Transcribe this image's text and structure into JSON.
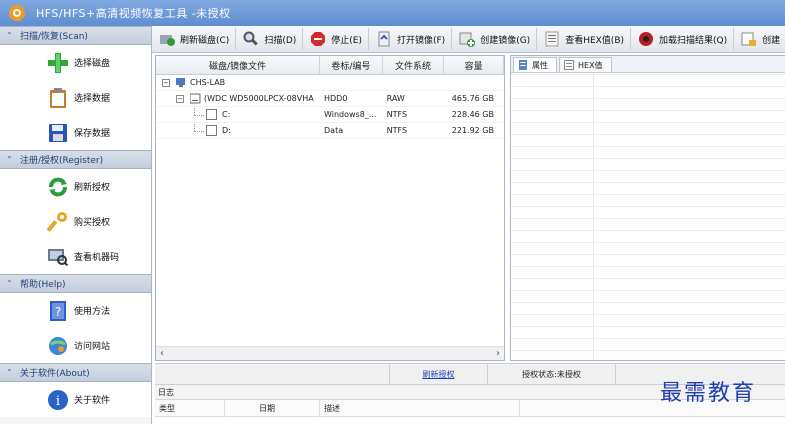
{
  "window": {
    "title": "HFS/HFS+高清视频恢复工具 -未授权",
    "logo_icon": "orange-gear-logo"
  },
  "sidebar": {
    "sections": [
      {
        "header": "扫描/恢复(Scan)",
        "items": [
          {
            "label": "选择磁盘",
            "icon": "green-plus-icon"
          },
          {
            "label": "选择数据",
            "icon": "clipboard-icon"
          },
          {
            "label": "保存数据",
            "icon": "floppy-disk-icon"
          }
        ]
      },
      {
        "header": "注册/授权(Register)",
        "items": [
          {
            "label": "刷新授权",
            "icon": "refresh-arrows-icon"
          },
          {
            "label": "购买授权",
            "icon": "key-icon"
          },
          {
            "label": "查看机器码",
            "icon": "monitor-search-icon"
          }
        ]
      },
      {
        "header": "帮助(Help)",
        "items": [
          {
            "label": "使用方法",
            "icon": "help-book-icon"
          },
          {
            "label": "访问网站",
            "icon": "globe-user-icon"
          }
        ]
      },
      {
        "header": "关于软件(About)",
        "items": [
          {
            "label": "关于软件",
            "icon": "info-icon"
          }
        ]
      }
    ]
  },
  "toolbar": {
    "buttons": [
      {
        "label": "刷新磁盘(C)",
        "icon": "refresh-disk-icon"
      },
      {
        "label": "扫描(D)",
        "icon": "magnifier-icon"
      },
      {
        "label": "停止(E)",
        "icon": "stop-icon"
      },
      {
        "label": "打开镜像(F)",
        "icon": "open-image-icon"
      },
      {
        "label": "创建镜像(G)",
        "icon": "create-image-icon"
      },
      {
        "label": "查看HEX值(B)",
        "icon": "hex-view-icon"
      },
      {
        "label": "加载扫描结果(Q)",
        "icon": "load-results-icon"
      },
      {
        "label": "创建",
        "icon": "create-icon"
      }
    ]
  },
  "tree": {
    "columns": [
      "磁盘/镜像文件",
      "卷标/编号",
      "文件系统",
      "容量"
    ],
    "rows": [
      {
        "name": "CHS-LAB",
        "label": "",
        "fs": "",
        "size": ""
      },
      {
        "name": "(WDC WD5000LPCX-08VHA",
        "label": "HDD0",
        "fs": "RAW",
        "size": "465.76 GB"
      },
      {
        "name": "C:",
        "label": "Windows8_...",
        "fs": "NTFS",
        "size": "228.46 GB"
      },
      {
        "name": "D:",
        "label": "Data",
        "fs": "NTFS",
        "size": "221.92 GB"
      }
    ]
  },
  "properties": {
    "tabs": [
      "属性",
      "HEX值"
    ]
  },
  "status": {
    "refresh_link": "刷新授权",
    "license_status": "授权状态:未授权"
  },
  "log": {
    "title": "日志",
    "columns": [
      "类型",
      "日期",
      "描述"
    ]
  },
  "watermark": "最需教育"
}
